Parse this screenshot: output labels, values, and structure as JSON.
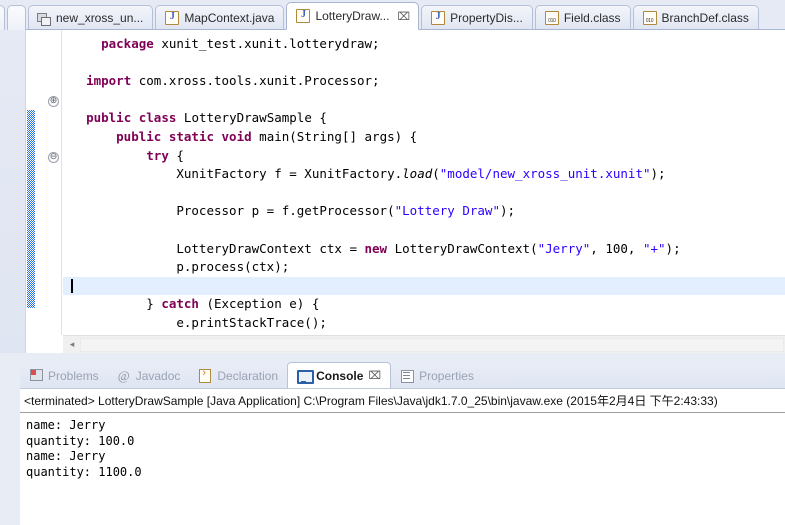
{
  "editor": {
    "tabs": [
      {
        "label": "new_xross_un...",
        "icon": "model-file-icon",
        "active": false,
        "partial": false,
        "icon_kind": "model"
      },
      {
        "label": "MapContext.java",
        "icon": "java-file-icon",
        "active": false,
        "partial": false,
        "icon_kind": "java"
      },
      {
        "label": "LotteryDraw...",
        "icon": "java-file-icon",
        "active": true,
        "partial": false,
        "icon_kind": "java",
        "close": "⌧"
      },
      {
        "label": "PropertyDis...",
        "icon": "java-file-icon",
        "active": false,
        "partial": false,
        "icon_kind": "java"
      },
      {
        "label": "Field.class",
        "icon": "class-file-icon",
        "active": false,
        "partial": false,
        "icon_kind": "class"
      },
      {
        "label": "BranchDef.class",
        "icon": "class-file-icon",
        "active": false,
        "partial": false,
        "icon_kind": "class"
      }
    ],
    "fold_markers": [
      {
        "symbol": "⊕",
        "name": "fold-expand-import"
      },
      {
        "symbol": "⊖",
        "name": "fold-collapse-main"
      }
    ],
    "hscroll_arrow": "◂",
    "code_lines": [
      [
        {
          "t": "    ",
          "c": ""
        },
        {
          "t": "package",
          "c": "kw"
        },
        {
          "t": " xunit_test.xunit.lotterydraw;",
          "c": ""
        }
      ],
      [
        {
          "t": "",
          "c": ""
        }
      ],
      [
        {
          "t": "  ",
          "c": ""
        },
        {
          "t": "import",
          "c": "kw"
        },
        {
          "t": " com.xross.tools.xunit.Processor;",
          "c": ""
        }
      ],
      [
        {
          "t": "",
          "c": ""
        }
      ],
      [
        {
          "t": "  ",
          "c": ""
        },
        {
          "t": "public",
          "c": "kw"
        },
        {
          "t": " ",
          "c": ""
        },
        {
          "t": "class",
          "c": "kw"
        },
        {
          "t": " LotteryDrawSample {",
          "c": ""
        }
      ],
      [
        {
          "t": "      ",
          "c": ""
        },
        {
          "t": "public",
          "c": "kw"
        },
        {
          "t": " ",
          "c": ""
        },
        {
          "t": "static",
          "c": "kw"
        },
        {
          "t": " ",
          "c": ""
        },
        {
          "t": "void",
          "c": "kw"
        },
        {
          "t": " main(String[] args) {",
          "c": ""
        }
      ],
      [
        {
          "t": "          ",
          "c": ""
        },
        {
          "t": "try",
          "c": "kw"
        },
        {
          "t": " {",
          "c": ""
        }
      ],
      [
        {
          "t": "              XunitFactory f = XunitFactory.",
          "c": ""
        },
        {
          "t": "load",
          "c": "sm"
        },
        {
          "t": "(",
          "c": ""
        },
        {
          "t": "\"model/new_xross_unit.xunit\"",
          "c": "str"
        },
        {
          "t": ");",
          "c": ""
        }
      ],
      [
        {
          "t": "",
          "c": ""
        }
      ],
      [
        {
          "t": "              Processor p = f.getProcessor(",
          "c": ""
        },
        {
          "t": "\"Lottery Draw\"",
          "c": "str"
        },
        {
          "t": ");",
          "c": ""
        }
      ],
      [
        {
          "t": "",
          "c": ""
        }
      ],
      [
        {
          "t": "              LotteryDrawContext ctx = ",
          "c": ""
        },
        {
          "t": "new",
          "c": "kw"
        },
        {
          "t": " LotteryDrawContext(",
          "c": ""
        },
        {
          "t": "\"Jerry\"",
          "c": "str"
        },
        {
          "t": ", 100, ",
          "c": ""
        },
        {
          "t": "\"+\"",
          "c": "str"
        },
        {
          "t": ");",
          "c": ""
        }
      ],
      [
        {
          "t": "              p.process(ctx);",
          "c": ""
        }
      ],
      [
        {
          "t": "",
          "c": "",
          "current": true
        }
      ],
      [
        {
          "t": "          } ",
          "c": ""
        },
        {
          "t": "catch",
          "c": "kw"
        },
        {
          "t": " (Exception e) {",
          "c": ""
        }
      ],
      [
        {
          "t": "              e.printStackTrace();",
          "c": ""
        }
      ],
      [
        {
          "t": "          }",
          "c": ""
        }
      ],
      [
        {
          "t": "      }",
          "c": ""
        }
      ],
      [
        {
          "t": "  }",
          "c": ""
        }
      ]
    ]
  },
  "console_view": {
    "tabs": [
      {
        "label": "Problems",
        "icon_kind": "problems",
        "active": false
      },
      {
        "label": "Javadoc",
        "icon_kind": "javadoc",
        "icon_glyph": "@",
        "active": false
      },
      {
        "label": "Declaration",
        "icon_kind": "declaration",
        "active": false
      },
      {
        "label": "Console",
        "icon_kind": "console",
        "active": true,
        "close": "⌧"
      },
      {
        "label": "Properties",
        "icon_kind": "properties",
        "active": false
      }
    ],
    "header": "<terminated> LotteryDrawSample [Java Application] C:\\Program Files\\Java\\jdk1.7.0_25\\bin\\javaw.exe (2015年2月4日 下午2:43:33)",
    "output": "name: Jerry\nquantity: 100.0\nname: Jerry\nquantity: 1100.0"
  },
  "colors": {
    "keyword": "#7F0055",
    "string": "#2A00FF",
    "current_line": "#E3EEFF",
    "change_bar": "#2B6FE0",
    "chrome": "#DFE5F2"
  }
}
